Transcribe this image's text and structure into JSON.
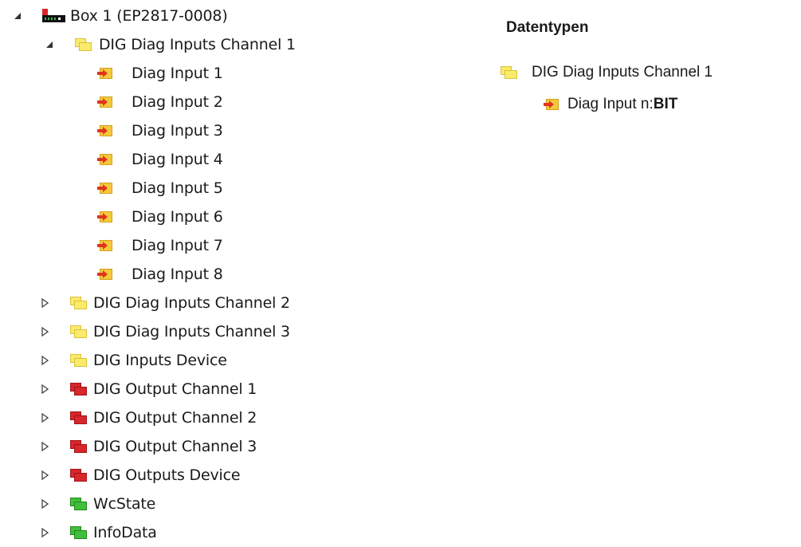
{
  "tree": {
    "box": {
      "label": "Box 1 (EP2817-0008)",
      "icon": "ethercat-box-icon",
      "expanded": true
    },
    "channel1": {
      "label": "DIG Diag Inputs Channel 1",
      "expanded": true,
      "inputs": [
        "Diag Input 1",
        "Diag Input 2",
        "Diag Input 3",
        "Diag Input 4",
        "Diag Input 5",
        "Diag Input 6",
        "Diag Input 7",
        "Diag Input 8"
      ]
    },
    "collapsed_nodes": [
      {
        "label": "DIG Diag Inputs Channel 2",
        "color": "yellow"
      },
      {
        "label": "DIG Diag Inputs Channel 3",
        "color": "yellow"
      },
      {
        "label": "DIG Inputs Device",
        "color": "yellow"
      },
      {
        "label": "DIG Output Channel 1",
        "color": "red"
      },
      {
        "label": "DIG Output Channel 2",
        "color": "red"
      },
      {
        "label": "DIG Output Channel 3",
        "color": "red"
      },
      {
        "label": "DIG Outputs Device",
        "color": "red"
      },
      {
        "label": "WcState",
        "color": "green"
      },
      {
        "label": "InfoData",
        "color": "green"
      }
    ]
  },
  "datatypes": {
    "heading": "Datentypen",
    "group_label": "DIG Diag Inputs Channel 1",
    "item_prefix": "Diag Input n: ",
    "item_type": "BIT"
  },
  "colors": {
    "yellow_fill": "#fbea6b",
    "yellow_border": "#d8c23a",
    "red_fill": "#d8262b",
    "red_border": "#9e1418",
    "green_fill": "#3fbf3a",
    "green_border": "#1f8a1b"
  }
}
